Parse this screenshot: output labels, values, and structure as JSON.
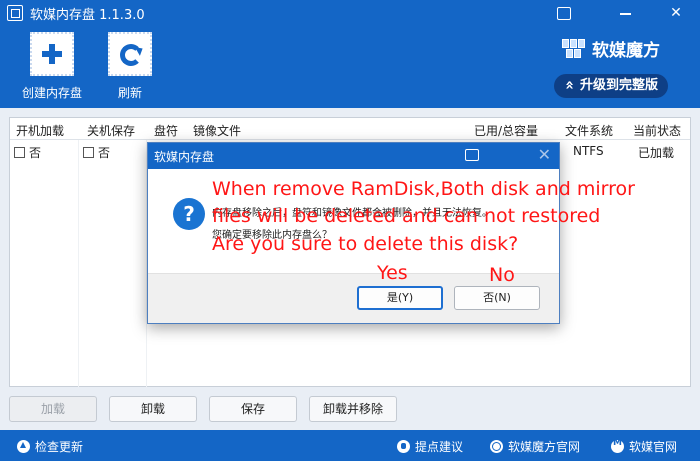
{
  "app": {
    "title": "软媒内存盘 1.1.3.0"
  },
  "toolbar": {
    "create_label": "创建内存盘",
    "refresh_label": "刷新",
    "brand_name": "软媒魔方",
    "upgrade_label": "升级到完整版"
  },
  "table": {
    "columns": [
      "开机加载",
      "关机保存",
      "盘符",
      "镜像文件",
      "已用/总容量",
      "文件系统",
      "当前状态"
    ],
    "rows": [
      {
        "boot_load": "否",
        "shutdown_save": "否",
        "drive": "",
        "image": "",
        "usage": "",
        "fs": "NTFS",
        "status": "已加载"
      }
    ]
  },
  "actions": {
    "load": "加载",
    "unload": "卸载",
    "save": "保存",
    "unload_remove": "卸载并移除"
  },
  "statusbar": {
    "check_update": "检查更新",
    "feedback": "提点建议",
    "official_site": "软媒魔方官网",
    "company_site": "软媒官网"
  },
  "dialog": {
    "title": "软媒内存盘",
    "message_line1": "内存盘移除之后，盘符和镜像文件都会被删除，并且无法恢复。",
    "message_line2": "您确定要移除此内存盘么？",
    "yes_label": "是(Y)",
    "no_label": "否(N)"
  },
  "annotations": {
    "line1": "When remove RamDisk,Both disk and mirror",
    "line2": "files will be deleted and can not restored",
    "line3": "Are you sure to delete this disk?",
    "yes": "Yes",
    "no": "No"
  },
  "colors": {
    "primary": "#1466c6",
    "annotation": "#ff1616",
    "upgrade_bg": "#0e3f86"
  }
}
